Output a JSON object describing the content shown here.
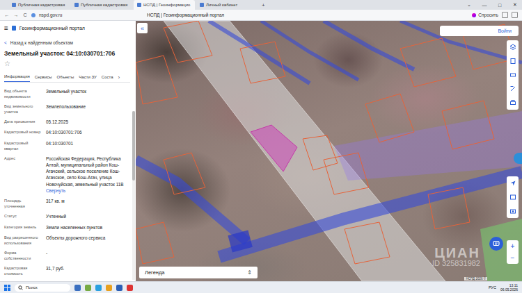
{
  "browser": {
    "tabs": [
      {
        "label": "Публичная кадастровая",
        "selected": false
      },
      {
        "label": "Публичная кадастровая",
        "selected": false
      },
      {
        "label": "НСПД | Геоинформацио",
        "selected": true
      },
      {
        "label": "Личный кабинет",
        "selected": false
      }
    ],
    "new_tab": "+",
    "window_controls": [
      "⌄",
      "—",
      "□",
      "✕"
    ],
    "nav": [
      "←",
      "→",
      "C"
    ],
    "url": "nspd.gov.ru",
    "page_title": "НСПД | Геоинформационный портал",
    "ask_button": "Спросить"
  },
  "portal": {
    "menu_icon": "≡",
    "title": "Геоинформационный портал"
  },
  "panel": {
    "back_icon": "<",
    "back": "Назад к найденным объектам",
    "heading": "Земельный участок: 04:10:030701:706",
    "star": "☆",
    "tabs": [
      {
        "label": "Информация",
        "selected": true
      },
      {
        "label": "Сервисы",
        "selected": false
      },
      {
        "label": "Объекты",
        "selected": false
      },
      {
        "label": "Части ЗУ",
        "selected": false
      },
      {
        "label": "Соста",
        "selected": false
      }
    ],
    "tabs_more": "›",
    "rows": [
      {
        "label": "Вид объекта недвижимости",
        "value": "Земельный участок"
      },
      {
        "label": "Вид земельного участка",
        "value": "Землепользование"
      },
      {
        "label": "Дата присвоения",
        "value": "05.12.2025"
      },
      {
        "label": "Кадастровый номер",
        "value": "04:10:030701:706"
      },
      {
        "label": "Кадастровый квартал",
        "value": "04:10:030701"
      },
      {
        "label": "Адрес",
        "value": "Российская Федерация, Республика Алтай, муниципальный район Кош-Агачский, сельское поселение Кош-Агачское, село Кош-Агач, улица Новочуйская, земельный участок 11В",
        "link": "Свернуть"
      },
      {
        "label": "Площадь уточненная",
        "value": "317 кв. м"
      },
      {
        "label": "Статус",
        "value": "Учтенный"
      },
      {
        "label": "Категория земель",
        "value": "Земли населенных пунктов"
      },
      {
        "label": "Вид разрешенного использования",
        "value": "Объекты дорожного сервиса"
      },
      {
        "label": "Форма собственности",
        "value": "-"
      },
      {
        "label": "Кадастровая стоимость",
        "value": "31,7 руб."
      }
    ]
  },
  "map": {
    "collapse": "«",
    "login": "Войти",
    "legend": {
      "label": "Легенда",
      "toggle": "⇕"
    },
    "zoom": [
      "+",
      "−"
    ],
    "attribution": "НСПД 2026 ©",
    "watermark": {
      "brand": "ЦИАН",
      "id": "ID 325831982"
    }
  },
  "taskbar": {
    "search": "Поиск",
    "lang": "РУС",
    "time": "13:11",
    "date": "06.05.2026"
  }
}
